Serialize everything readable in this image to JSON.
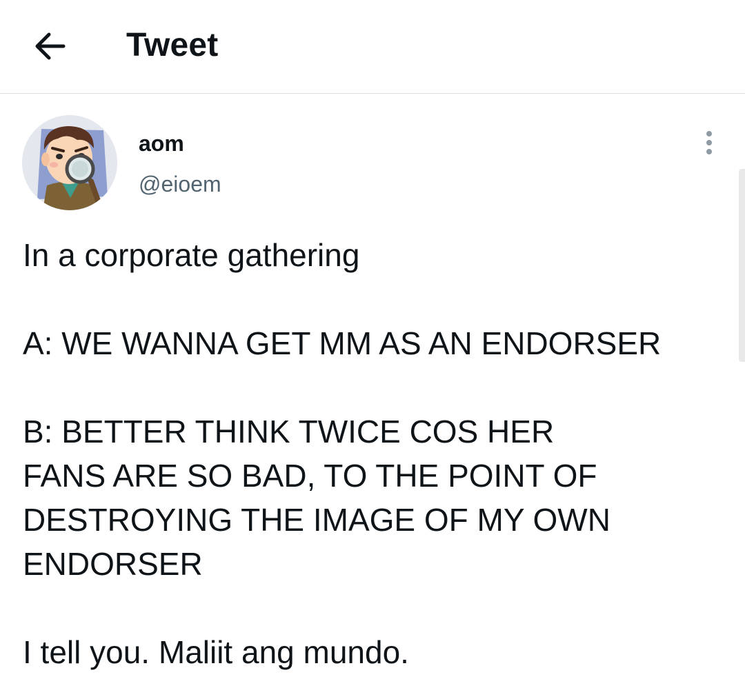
{
  "header": {
    "title": "Tweet",
    "back_icon": "arrow-left-icon"
  },
  "tweet": {
    "author": {
      "display_name": "aom",
      "handle": "@eioem",
      "avatar": "cartoon-detective-avatar"
    },
    "more_icon": "more-vertical-icon",
    "text": "In a corporate gathering\n\nA: WE WANNA GET MM AS AN ENDORSER\n\nB: BETTER THINK TWICE COS HER\nFANS ARE SO BAD, TO THE POINT OF\nDESTROYING THE IMAGE OF MY OWN\nENDORSER\n\nI tell you. Maliit ang mundo."
  },
  "colors": {
    "text_primary": "#0f1419",
    "text_secondary": "#536471",
    "divider": "#dcdfe2",
    "background": "#ffffff"
  }
}
